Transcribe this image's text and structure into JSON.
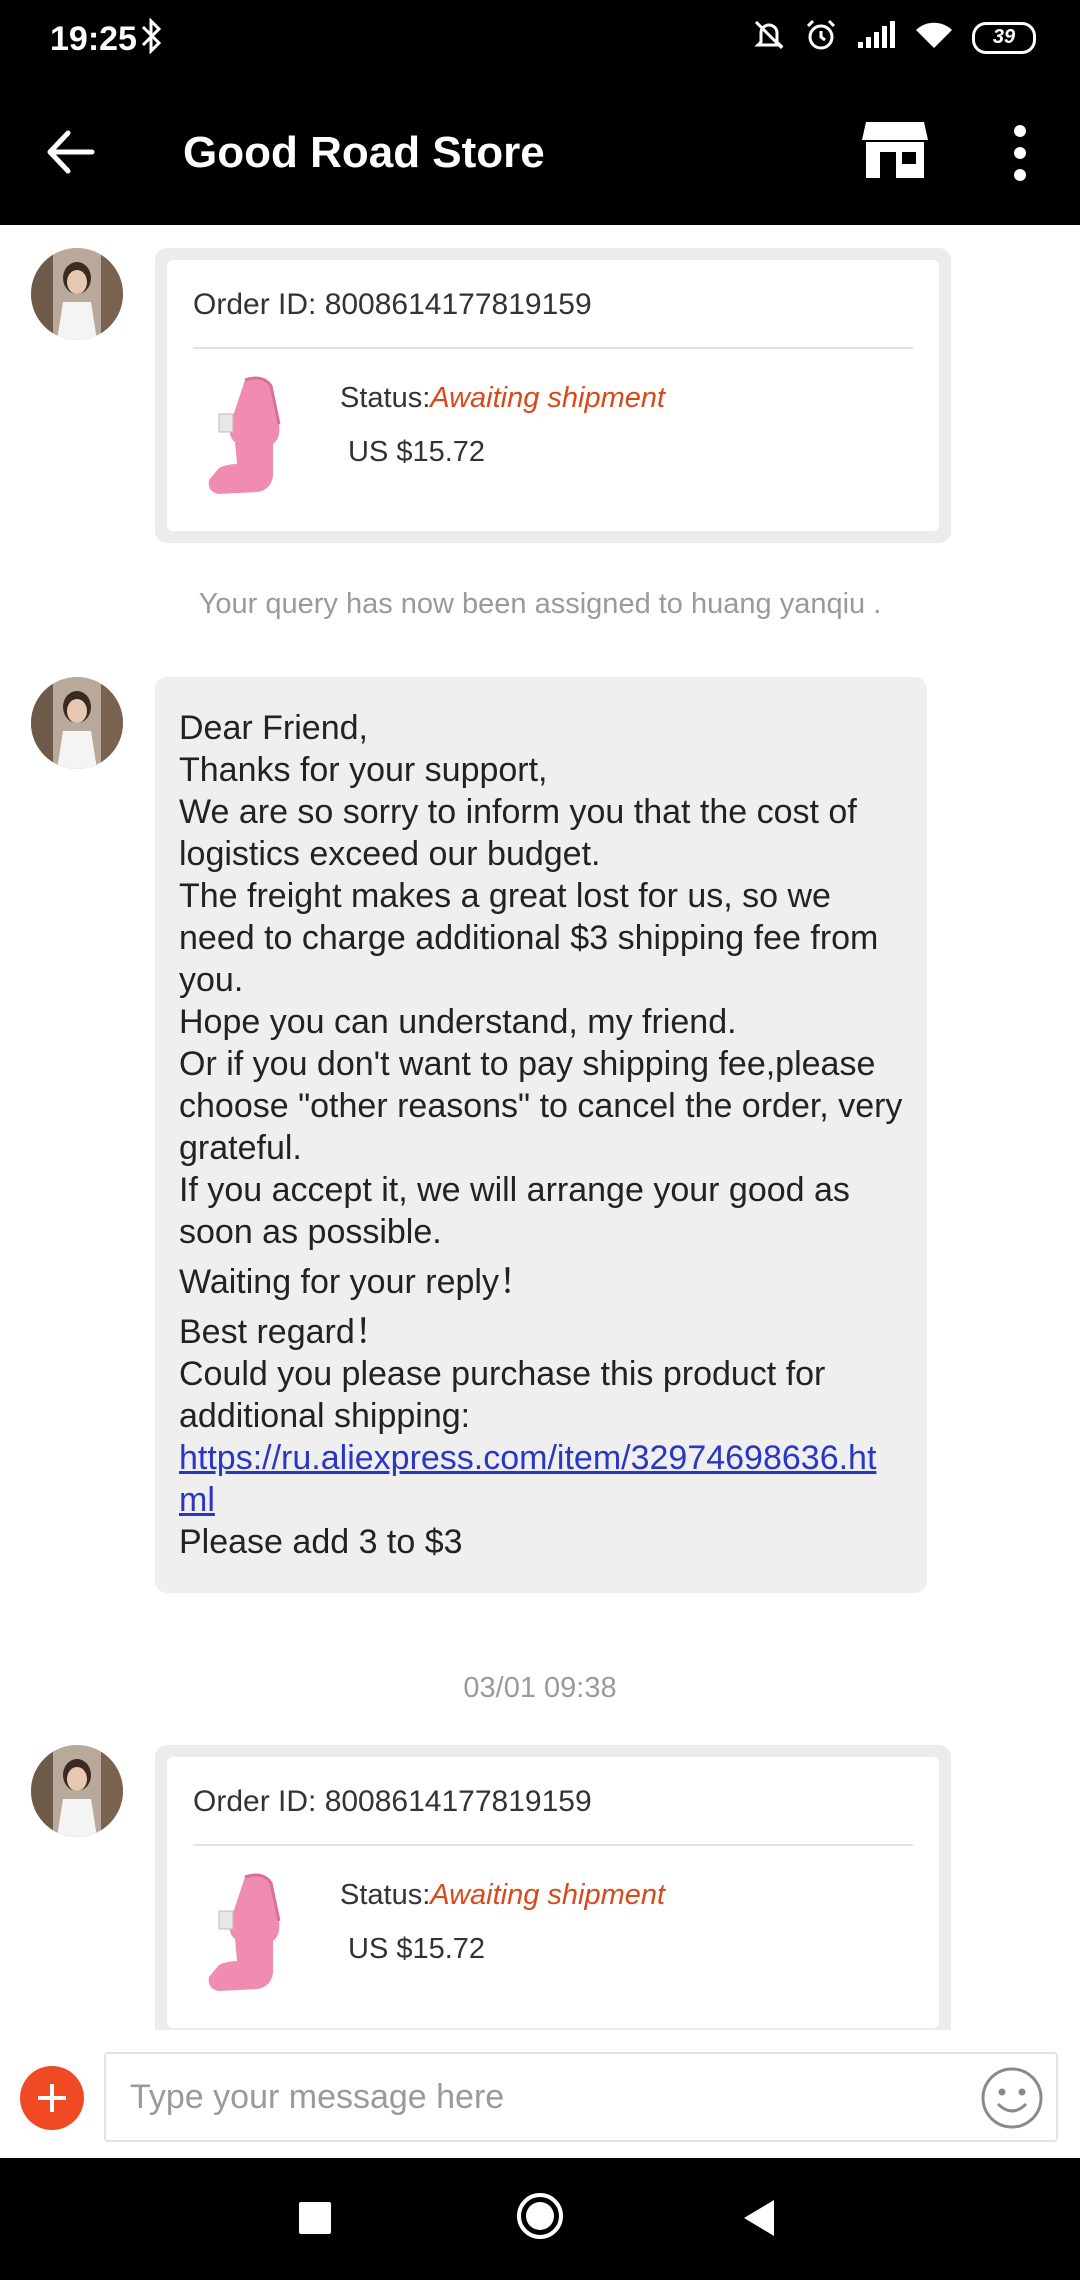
{
  "status_bar": {
    "time": "19:25",
    "battery": "39"
  },
  "header": {
    "title": "Good Road Store"
  },
  "messages": {
    "order_card_1": {
      "order_id": "Order ID: 8008614177819159",
      "status_label": "Status:",
      "status_value": "Awaiting shipment",
      "price": "US $15.72"
    },
    "system_note": "Your query has now been assigned to huang yanqiu .",
    "seller_message": {
      "line_1": "Dear Friend,",
      "line_2": "Thanks for your support,",
      "line_3": "We are so sorry to inform you that the cost of logistics exceed our budget.",
      "line_4": "The freight makes a great lost for us, so we need to charge additional $3 shipping fee from you.",
      "line_5": "Hope you can understand, my friend.",
      "line_6": "Or if you don't want to pay shipping fee,please choose \"other reasons\" to cancel the order, very grateful.",
      "line_7": "If you accept it, we will arrange your good as soon as possible.",
      "line_8": "Waiting for your reply！",
      "line_9": "Best regard！",
      "line_10": "Could you please purchase this product for additional shipping:",
      "link": "https://ru.aliexpress.com/item/32974698636.html",
      "line_11": "Please add 3 to $3"
    },
    "timestamp": "03/01 09:38",
    "order_card_2": {
      "order_id": "Order ID: 8008614177819159",
      "status_label": "Status:",
      "status_value": "Awaiting shipment",
      "price": "US $15.72"
    }
  },
  "input": {
    "placeholder": "Type your message here",
    "value": ""
  },
  "colors": {
    "status_accent": "#d8491b",
    "add_button": "#f04a25",
    "link": "#2a37c4",
    "bubble": "#efefef"
  },
  "icons": [
    "back-arrow-icon",
    "store-icon",
    "more-vertical-icon",
    "plus-icon",
    "emoji-icon",
    "bluetooth-icon",
    "wifi-icon",
    "signal-icon",
    "alarm-icon",
    "mute-icon"
  ]
}
